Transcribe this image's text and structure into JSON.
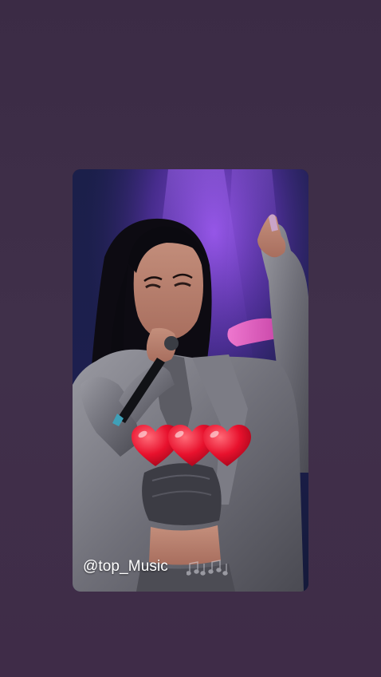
{
  "story": {
    "username_label": "@top_Music",
    "music_icon": "music-notes-icon",
    "hearts_icon": "red-hearts-sticker"
  },
  "colors": {
    "background": "#3f2d48",
    "stage_purple": "#7a3fd0",
    "stage_pink": "#e04fb5",
    "heart_red": "#e8112d",
    "jacket_silver": "#8f8f95"
  }
}
